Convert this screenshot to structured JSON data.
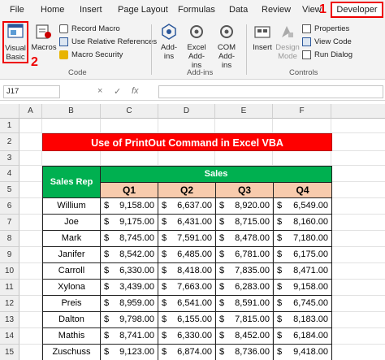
{
  "menu": {
    "tabs": [
      "File",
      "Home",
      "Insert",
      "Page Layout",
      "Formulas",
      "Data",
      "Review",
      "View"
    ],
    "developer": "Developer",
    "marker1": "1",
    "marker2": "2"
  },
  "ribbon": {
    "visual_basic": "Visual Basic",
    "macros": "Macros",
    "record_macro": "Record Macro",
    "relative_refs": "Use Relative References",
    "macro_security": "Macro Security",
    "group_code": "Code",
    "addins": "Add-ins",
    "excel_addins": "Excel Add-ins",
    "com_addins": "COM Add-ins",
    "group_addins": "Add-ins",
    "insert": "Insert",
    "design_mode": "Design Mode",
    "properties": "Properties",
    "view_code": "View Code",
    "run_dialog": "Run Dialog",
    "group_controls": "Controls"
  },
  "formula_bar": {
    "name_box": "J17",
    "fx": "fx",
    "cancel": "×",
    "enter": "✓"
  },
  "columns": [
    "A",
    "B",
    "C",
    "D",
    "E",
    "F"
  ],
  "rows": [
    "1",
    "2",
    "3",
    "4",
    "5",
    "6",
    "7",
    "8",
    "9",
    "10",
    "11",
    "12",
    "13",
    "14",
    "15"
  ],
  "sheet": {
    "title": "Use of PrintOut Command in Excel VBA",
    "sales_rep_header": "Sales Rep",
    "sales_header": "Sales",
    "quarters": [
      "Q1",
      "Q2",
      "Q3",
      "Q4"
    ],
    "currency": "$",
    "data": [
      {
        "name": "Willium",
        "q": [
          "9,158.00",
          "6,637.00",
          "8,920.00",
          "6,549.00"
        ]
      },
      {
        "name": "Joe",
        "q": [
          "9,175.00",
          "6,431.00",
          "8,715.00",
          "8,160.00"
        ]
      },
      {
        "name": "Mark",
        "q": [
          "8,745.00",
          "7,591.00",
          "8,478.00",
          "7,180.00"
        ]
      },
      {
        "name": "Janifer",
        "q": [
          "8,542.00",
          "6,485.00",
          "6,781.00",
          "6,175.00"
        ]
      },
      {
        "name": "Carroll",
        "q": [
          "6,330.00",
          "8,418.00",
          "7,835.00",
          "8,471.00"
        ]
      },
      {
        "name": "Xylona",
        "q": [
          "3,439.00",
          "7,663.00",
          "6,283.00",
          "9,158.00"
        ]
      },
      {
        "name": "Preis",
        "q": [
          "8,959.00",
          "6,541.00",
          "8,591.00",
          "6,745.00"
        ]
      },
      {
        "name": "Dalton",
        "q": [
          "9,798.00",
          "6,155.00",
          "7,815.00",
          "8,183.00"
        ]
      },
      {
        "name": "Mathis",
        "q": [
          "8,741.00",
          "6,330.00",
          "8,452.00",
          "6,184.00"
        ]
      },
      {
        "name": "Zuschuss",
        "q": [
          "9,123.00",
          "6,874.00",
          "8,736.00",
          "9,418.00"
        ]
      }
    ]
  }
}
